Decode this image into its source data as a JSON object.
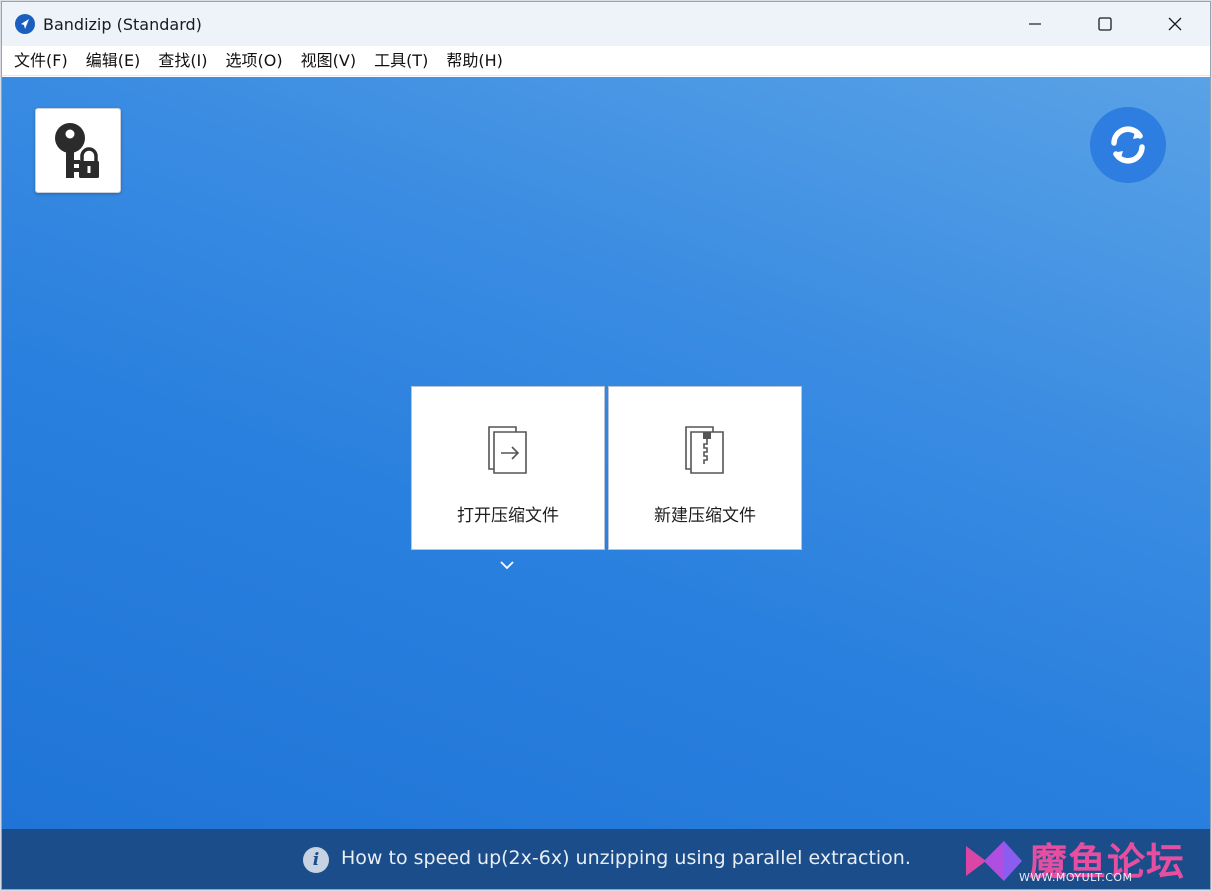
{
  "window": {
    "title": "Bandizip (Standard)"
  },
  "menubar": {
    "items": [
      {
        "label": "文件(F)"
      },
      {
        "label": "编辑(E)"
      },
      {
        "label": "查找(I)"
      },
      {
        "label": "选项(O)"
      },
      {
        "label": "视图(V)"
      },
      {
        "label": "工具(T)"
      },
      {
        "label": "帮助(H)"
      }
    ]
  },
  "main": {
    "tiles": [
      {
        "label": "打开压缩文件",
        "icon": "open-archive-icon"
      },
      {
        "label": "新建压缩文件",
        "icon": "new-archive-icon"
      }
    ]
  },
  "statusbar": {
    "tip": "How to speed up(2x-6x) unzipping using parallel extraction."
  },
  "watermark": {
    "title": "魔鱼论坛",
    "url": "WWW.MOYULT.COM"
  },
  "colors": {
    "accent": "#2a80de",
    "statusbar": "#1a4d8a",
    "watermark": "#e64ea0"
  }
}
